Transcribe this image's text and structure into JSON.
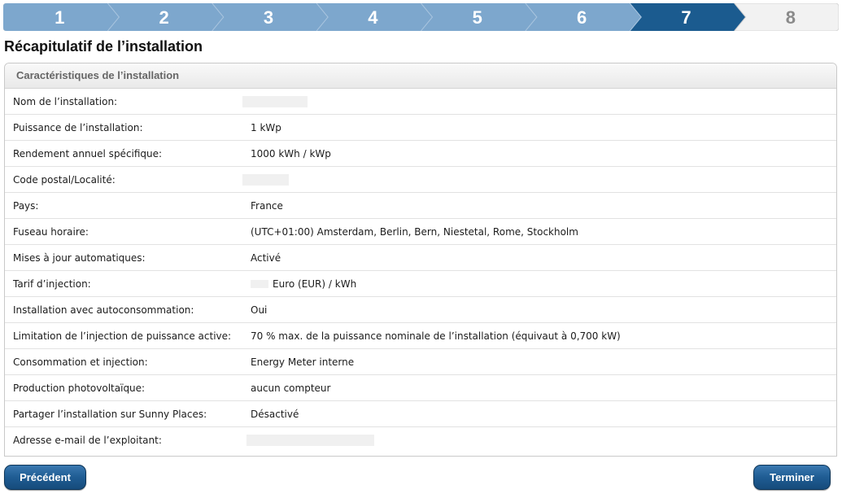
{
  "stepper": {
    "steps": [
      "1",
      "2",
      "3",
      "4",
      "5",
      "6",
      "7",
      "8"
    ],
    "current_step": "7",
    "colors": {
      "completed": "#7da7cd",
      "current": "#1b5b8f",
      "upcoming": "#f2f2f2",
      "completed_text": "#ffffff",
      "upcoming_text": "#8a8a8a"
    }
  },
  "page": {
    "title": "Récapitulatif de l’installation"
  },
  "panel": {
    "header": "Caractéristiques de l’installation",
    "rows": [
      {
        "label": "Nom de l’installation:",
        "value": "",
        "redacted": true
      },
      {
        "label": "Puissance de l’installation:",
        "value": "1 kWp"
      },
      {
        "label": "Rendement annuel spécifique:",
        "value": "1000 kWh / kWp"
      },
      {
        "label": "Code postal/Localité:",
        "value": "",
        "redacted": true
      },
      {
        "label": "Pays:",
        "value": "France"
      },
      {
        "label": "Fuseau horaire:",
        "value": "(UTC+01:00) Amsterdam, Berlin, Bern, Niestetal, Rome, Stockholm"
      },
      {
        "label": "Mises à jour automatiques:",
        "value": "Activé"
      },
      {
        "label": "Tarif d’injection:",
        "value": "Euro (EUR) / kWh",
        "redacted_prefix": true
      },
      {
        "label": "Installation avec autoconsommation:",
        "value": "Oui"
      },
      {
        "label": "Limitation de l’injection de puissance active:",
        "value": "70 % max. de la puissance nominale de l’installation (équivaut à 0,700 kW)"
      },
      {
        "label": "Consommation et injection:",
        "value": "Energy Meter interne"
      },
      {
        "label": "Production photovoltaïque:",
        "value": "aucun compteur"
      },
      {
        "label": "Partager l’installation sur Sunny Places:",
        "value": "Désactivé"
      },
      {
        "label": "Adresse e-mail de l’exploitant:",
        "value": "",
        "redacted": true
      }
    ]
  },
  "buttons": {
    "previous": "Précédent",
    "finish": "Terminer"
  }
}
